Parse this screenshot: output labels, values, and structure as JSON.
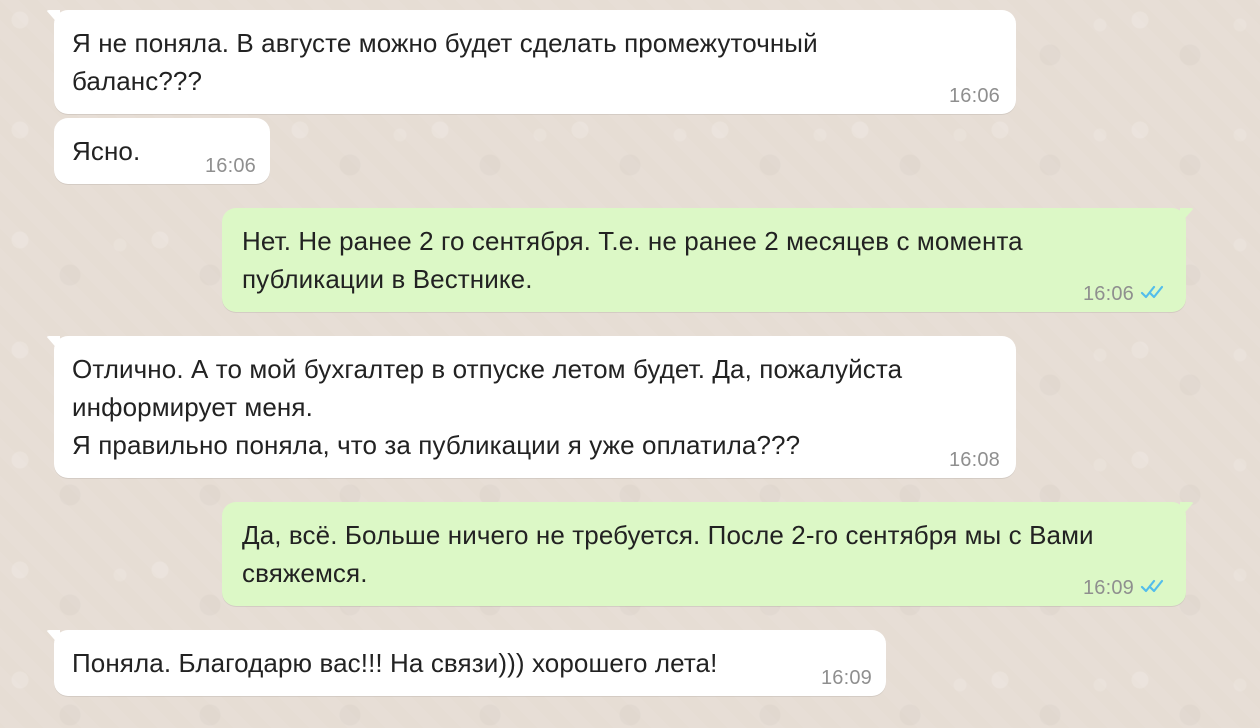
{
  "chat": {
    "messages": [
      {
        "direction": "incoming",
        "text": "Я не поняла. В августе можно будет сделать промежуточный\nбаланс???",
        "time": "16:06"
      },
      {
        "direction": "incoming",
        "text": "Ясно.",
        "time": "16:06"
      },
      {
        "direction": "outgoing",
        "text": "Нет. Не ранее 2 го сентября. Т.е. не ранее 2 месяцев с момента\nпубликации в Вестнике.",
        "time": "16:06",
        "status_icon": "double-check-read-icon"
      },
      {
        "direction": "incoming",
        "text": "Отлично. А то мой бухгалтер в отпуске летом будет. Да, пожалуйста\nинформирует меня.\nЯ правильно поняла, что за публикации я уже оплатила???",
        "time": "16:08"
      },
      {
        "direction": "outgoing",
        "text": "Да, всё. Больше ничего не требуется. После 2-го сентября мы с Вами\nсвяжемся.",
        "time": "16:09",
        "status_icon": "double-check-read-icon"
      },
      {
        "direction": "incoming",
        "text": "Поняла. Благодарю вас!!! На связи))) хорошего лета!",
        "time": "16:09"
      }
    ]
  },
  "colors": {
    "background": "#e6ddd4",
    "incoming_bubble": "#ffffff",
    "outgoing_bubble": "#dcf8c6",
    "timestamp": "#8f8f8f",
    "read_checks": "#53bdeb",
    "text": "#222222"
  }
}
